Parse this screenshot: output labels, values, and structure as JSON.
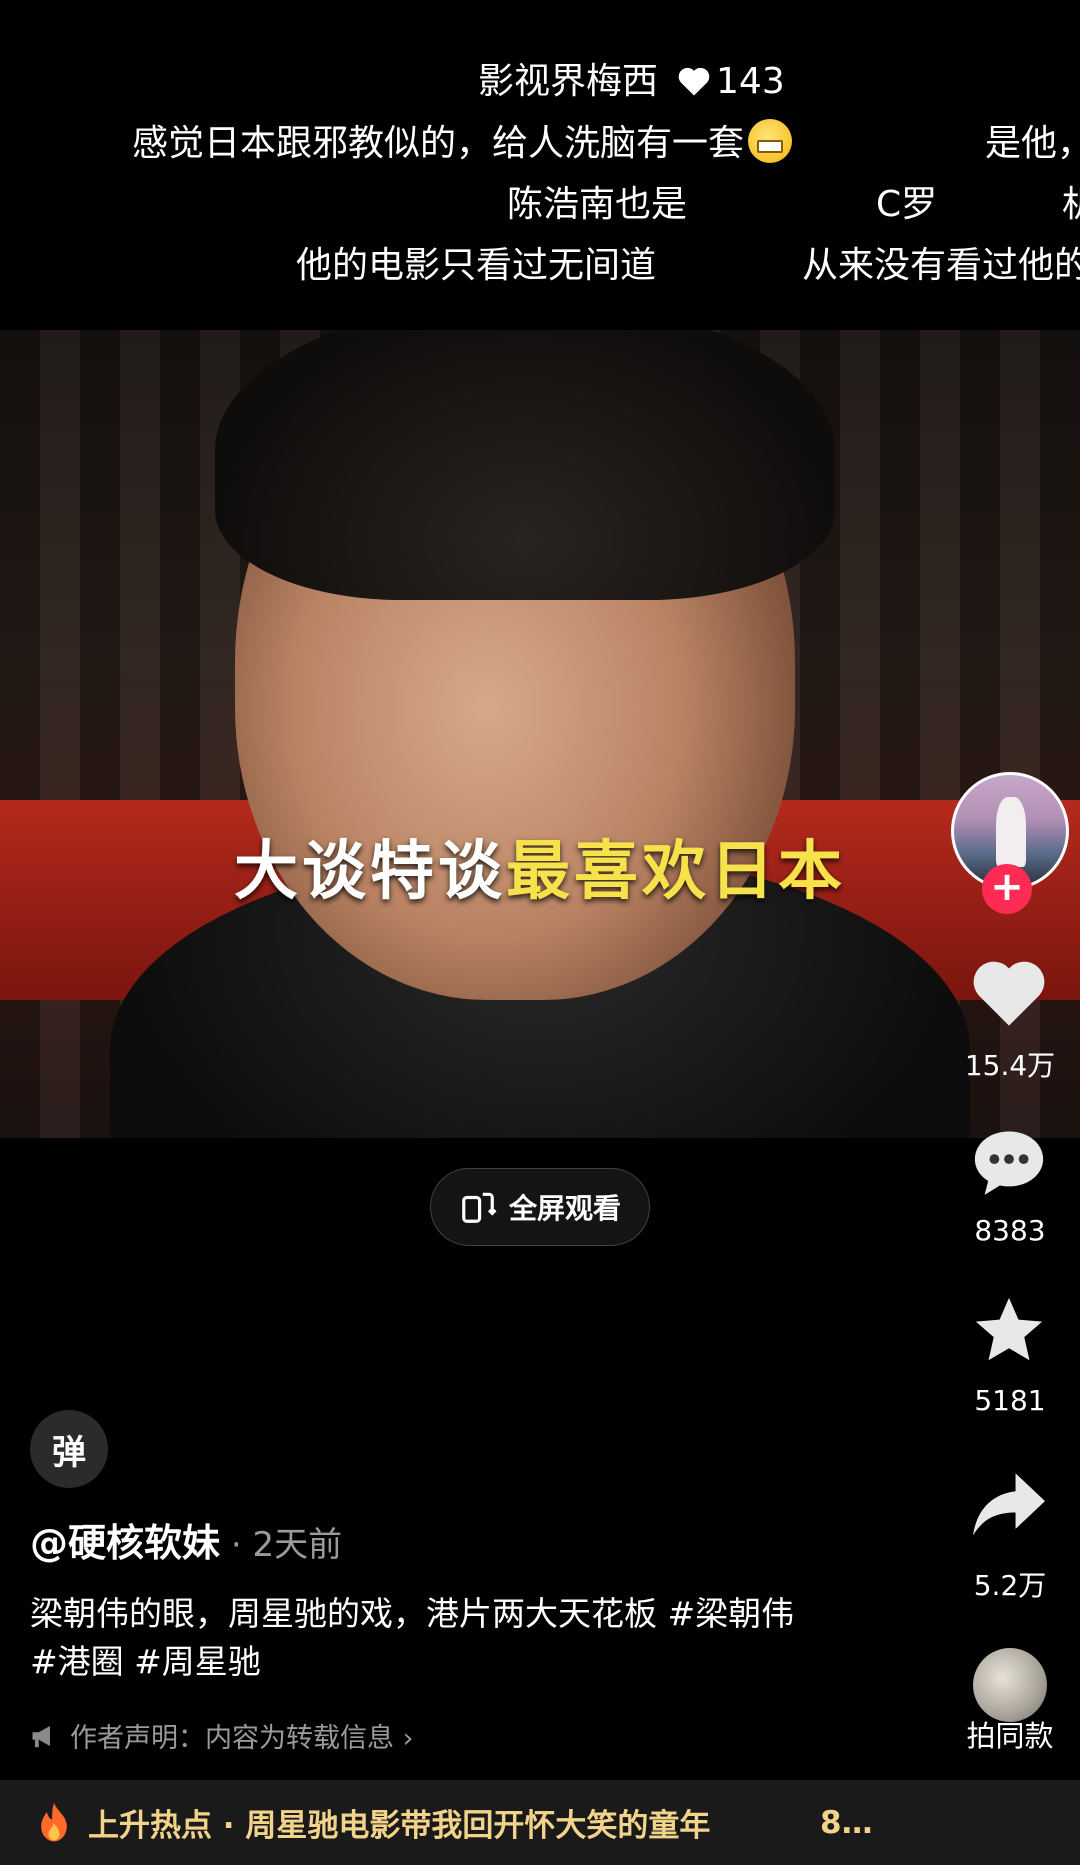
{
  "danmaku": {
    "line1_name": "影视界梅西",
    "line1_likes": "143",
    "line2a": "感觉日本跟邪教似的，给人洗脑有一套",
    "line2b": "是他，",
    "line3a": "陈浩南也是",
    "line3b": "C罗",
    "line3c": "机",
    "line4a": "他的电影只看过无间道",
    "line4b": "从来没有看过他的"
  },
  "video": {
    "subtitle_white": "大谈特谈",
    "subtitle_yellow": "最喜欢日本"
  },
  "fullscreen_label": "全屏观看",
  "actions": {
    "likes": "15.4万",
    "comments": "8383",
    "favorites": "5181",
    "shares": "5.2万",
    "same_style": "拍同款"
  },
  "danmaku_toggle": "弹",
  "post": {
    "author": "@硬核软妹",
    "separator": " · ",
    "time": "2天前",
    "caption": "梁朝伟的眼，周星驰的戏，港片两大天花板 #梁朝伟 #港圈 #周星驰",
    "notice": "作者声明：内容为转载信息 ›"
  },
  "hot": {
    "text": "上升热点 · 周星驰电影带我回开怀大笑的童年",
    "views": "8…"
  },
  "colors": {
    "accent": "#fe2c55",
    "highlight": "#f7e24b",
    "hot": "#f2d38a"
  }
}
